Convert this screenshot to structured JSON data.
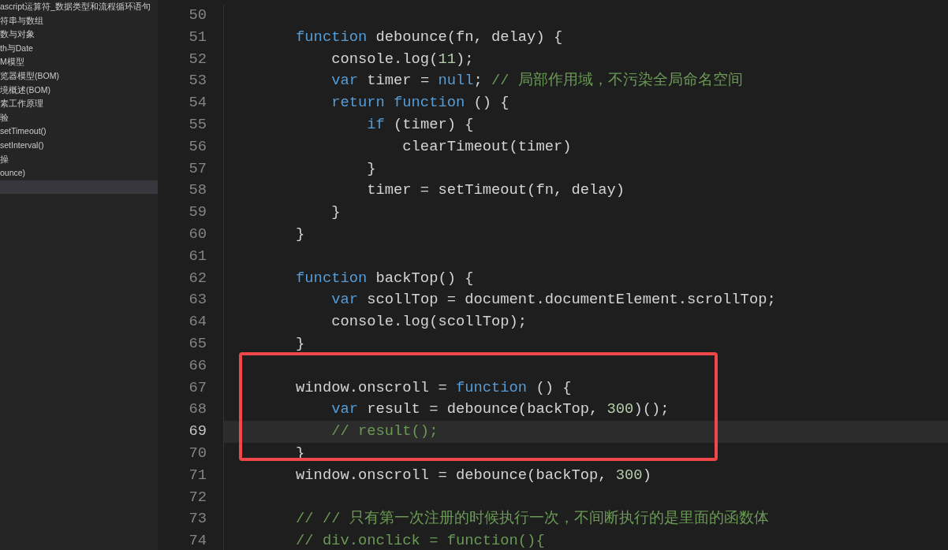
{
  "sidebar": {
    "items": [
      {
        "label": "ascript运算符_数据类型和流程循环语句",
        "selected": false
      },
      {
        "label": "符串与数组",
        "selected": false
      },
      {
        "label": "数与对象",
        "selected": false
      },
      {
        "label": "th与Date",
        "selected": false
      },
      {
        "label": "M模型",
        "selected": false
      },
      {
        "label": "览器模型(BOM)",
        "selected": false
      },
      {
        "label": "境概述(BOM)",
        "selected": false
      },
      {
        "label": "素工作原理",
        "selected": false
      },
      {
        "label": "验",
        "selected": false
      },
      {
        "label": "setTimeout()",
        "selected": false
      },
      {
        "label": "setInterval()",
        "selected": false
      },
      {
        "label": "操",
        "selected": false
      },
      {
        "label": "ounce)",
        "selected": false
      },
      {
        "selected": true
      }
    ]
  },
  "editor": {
    "lines": [
      {
        "number": "50",
        "current": false
      },
      {
        "number": "51",
        "current": false,
        "tokens": [
          {
            "kind": "keyword",
            "text": "    function"
          },
          {
            "kind": "plain",
            "text": " debounce(fn, delay) {"
          }
        ]
      },
      {
        "number": "52",
        "current": false,
        "tokens": [
          {
            "kind": "plain",
            "text": "        console.log("
          },
          {
            "kind": "number",
            "text": "11"
          },
          {
            "kind": "plain",
            "text": ");"
          }
        ]
      },
      {
        "number": "53",
        "current": false,
        "tokens": [
          {
            "kind": "keyword",
            "text": "        var"
          },
          {
            "kind": "plain",
            "text": " timer = "
          },
          {
            "kind": "keyword",
            "text": "null"
          },
          {
            "kind": "plain",
            "text": "; "
          },
          {
            "kind": "comment",
            "text": "// 局部作用域，不污染全局命名空间"
          }
        ]
      },
      {
        "number": "54",
        "current": false,
        "tokens": [
          {
            "kind": "keyword",
            "text": "        return function"
          },
          {
            "kind": "plain",
            "text": " () {"
          }
        ]
      },
      {
        "number": "55",
        "current": false,
        "tokens": [
          {
            "kind": "keyword",
            "text": "            if"
          },
          {
            "kind": "plain",
            "text": " (timer) {"
          }
        ]
      },
      {
        "number": "56",
        "current": false,
        "tokens": [
          {
            "kind": "plain",
            "text": "                clearTimeout(timer)"
          }
        ]
      },
      {
        "number": "57",
        "current": false,
        "tokens": [
          {
            "kind": "plain",
            "text": "            }"
          }
        ]
      },
      {
        "number": "58",
        "current": false,
        "tokens": [
          {
            "kind": "plain",
            "text": "            timer = setTimeout(fn, delay)"
          }
        ]
      },
      {
        "number": "59",
        "current": false,
        "tokens": [
          {
            "kind": "plain",
            "text": "        }"
          }
        ]
      },
      {
        "number": "60",
        "current": false,
        "tokens": [
          {
            "kind": "plain",
            "text": "    }"
          }
        ]
      },
      {
        "number": "61",
        "current": false
      },
      {
        "number": "62",
        "current": false,
        "tokens": [
          {
            "kind": "keyword",
            "text": "    function"
          },
          {
            "kind": "plain",
            "text": " backTop() {"
          }
        ]
      },
      {
        "number": "63",
        "current": false,
        "tokens": [
          {
            "kind": "keyword",
            "text": "        var"
          },
          {
            "kind": "plain",
            "text": " scollTop = document.documentElement.scrollTop;"
          }
        ]
      },
      {
        "number": "64",
        "current": false,
        "tokens": [
          {
            "kind": "plain",
            "text": "        console.log(scollTop);"
          }
        ]
      },
      {
        "number": "65",
        "current": false,
        "tokens": [
          {
            "kind": "plain",
            "text": "    }"
          }
        ]
      },
      {
        "number": "66",
        "current": false
      },
      {
        "number": "67",
        "current": false,
        "tokens": [
          {
            "kind": "plain",
            "text": "    window.onscroll = "
          },
          {
            "kind": "keyword",
            "text": "function"
          },
          {
            "kind": "plain",
            "text": " () {"
          }
        ]
      },
      {
        "number": "68",
        "current": false,
        "tokens": [
          {
            "kind": "keyword",
            "text": "        var"
          },
          {
            "kind": "plain",
            "text": " result = debounce(backTop, "
          },
          {
            "kind": "number",
            "text": "300"
          },
          {
            "kind": "plain",
            "text": ")();"
          }
        ]
      },
      {
        "number": "69",
        "current": true,
        "tokens": [
          {
            "kind": "comment",
            "text": "        // result();"
          }
        ]
      },
      {
        "number": "70",
        "current": false,
        "tokens": [
          {
            "kind": "plain",
            "text": "    }"
          }
        ]
      },
      {
        "number": "71",
        "current": false,
        "tokens": [
          {
            "kind": "plain",
            "text": "    window.onscroll = debounce(backTop, "
          },
          {
            "kind": "number",
            "text": "300"
          },
          {
            "kind": "plain",
            "text": ")"
          }
        ]
      },
      {
        "number": "72",
        "current": false
      },
      {
        "number": "73",
        "current": false,
        "tokens": [
          {
            "kind": "comment",
            "text": "    // // 只有第一次注册的时候执行一次，不间断执行的是里面的函数体"
          }
        ]
      },
      {
        "number": "74",
        "current": false,
        "tokens": [
          {
            "kind": "comment",
            "text": "    // div.onclick = function(){"
          }
        ]
      }
    ]
  }
}
